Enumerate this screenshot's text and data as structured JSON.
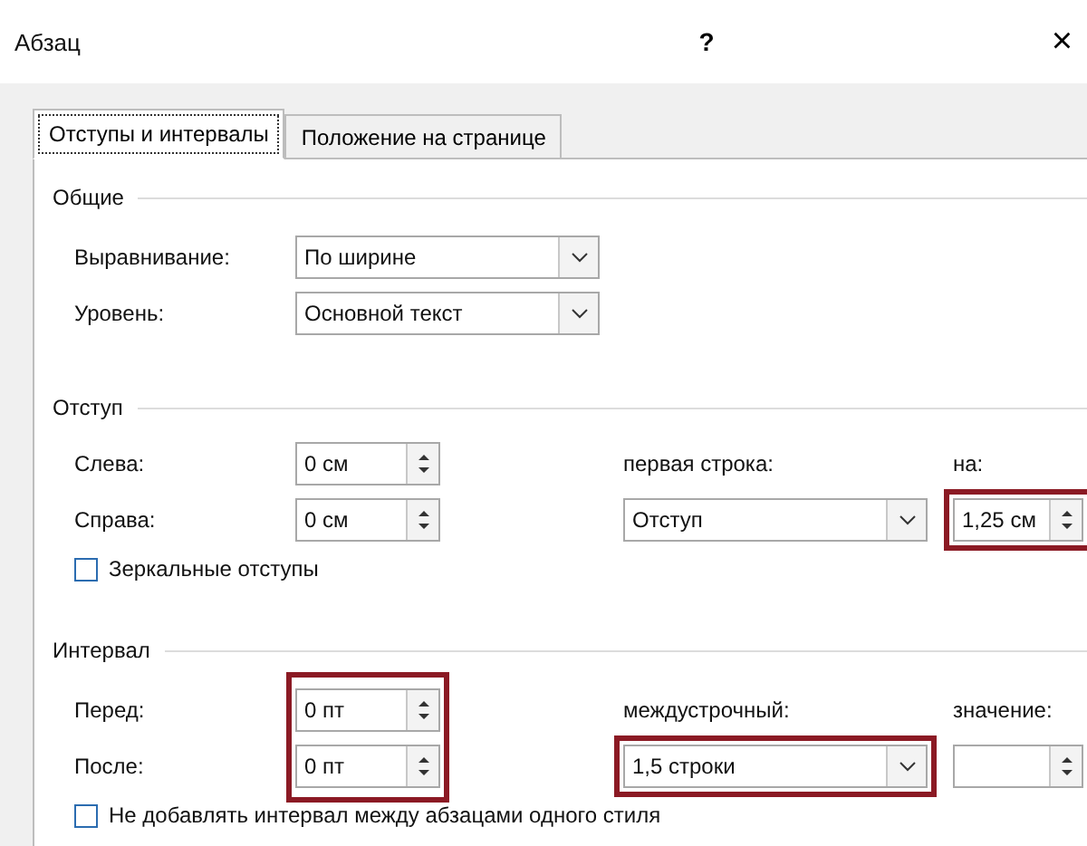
{
  "window": {
    "title": "Абзац",
    "help": "?",
    "close": "×"
  },
  "tabs": [
    {
      "label": "Отступы и интервалы",
      "selected": true
    },
    {
      "label": "Положение на странице",
      "selected": false
    }
  ],
  "general": {
    "title": "Общие",
    "fields": [
      {
        "label": "Выравнивание:",
        "value": "По ширине"
      },
      {
        "label": "Уровень:",
        "value": "Основной текст"
      }
    ]
  },
  "indent": {
    "title": "Отступ",
    "left": {
      "label": "Слева:",
      "value": "0 см"
    },
    "right": {
      "label": "Справа:",
      "value": "0 см"
    },
    "first_line": {
      "label": "первая строка:",
      "value": "Отступ",
      "highlighted": false
    },
    "by": {
      "label": "на:",
      "value": "1,25 см",
      "highlighted": true
    },
    "mirror": {
      "label": "Зеркальные отступы",
      "checked": false
    }
  },
  "spacing": {
    "title": "Интервал",
    "before": {
      "label": "Перед:",
      "value": "0 пт"
    },
    "after": {
      "label": "После:",
      "value": "0 пт"
    },
    "before_after_highlighted": true,
    "line_spacing": {
      "label": "междустрочный:",
      "value": "1,5 строки",
      "highlighted": true
    },
    "at": {
      "label": "значение:",
      "highlighted": false
    },
    "no_space": {
      "label": "Не добавлять интервал между абзацами одного стиля",
      "checked": false
    }
  }
}
